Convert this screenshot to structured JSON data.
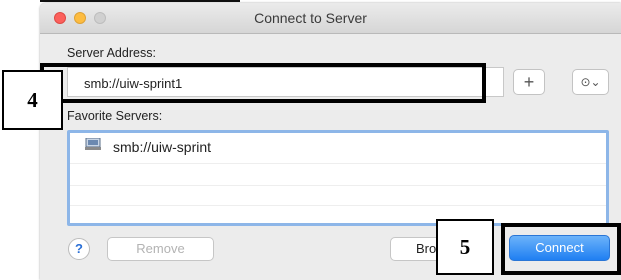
{
  "window": {
    "title": "Connect to Server"
  },
  "server_address": {
    "label": "Server Address:",
    "value": "smb://uiw-sprint1",
    "add_symbol": "+",
    "recent_symbol": "⊙⌄"
  },
  "favorites": {
    "label": "Favorite Servers:",
    "items": [
      {
        "label": "smb://uiw-sprint"
      }
    ]
  },
  "footer": {
    "help": "?",
    "remove": "Remove",
    "browse": "Bro",
    "connect": "Connect"
  },
  "callouts": {
    "step_4": "4",
    "step_5": "5"
  },
  "colors": {
    "connect_blue": "#1f7ff2",
    "selection_blue": "#8db6e8"
  }
}
